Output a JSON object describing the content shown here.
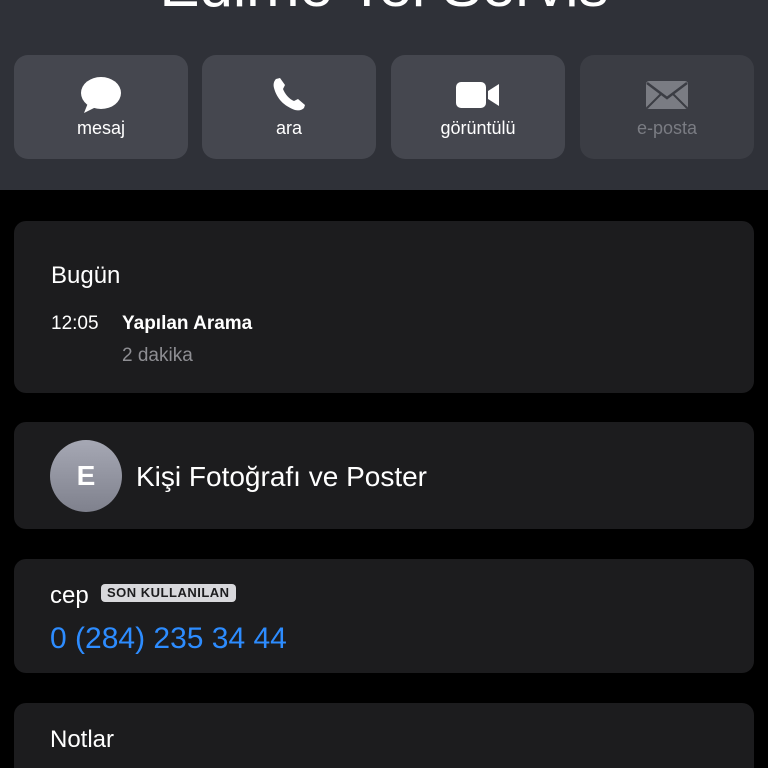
{
  "contact": {
    "name": "Edirne Tel Servis",
    "initial": "E"
  },
  "actions": [
    {
      "label": "mesaj",
      "icon": "message-bubble-icon",
      "enabled": true
    },
    {
      "label": "ara",
      "icon": "phone-icon",
      "enabled": true
    },
    {
      "label": "görüntülü",
      "icon": "video-camera-icon",
      "enabled": true
    },
    {
      "label": "e-posta",
      "icon": "envelope-icon",
      "enabled": false
    }
  ],
  "recents": {
    "title": "Bugün",
    "entries": [
      {
        "time": "12:05",
        "type": "Yapılan Arama",
        "duration": "2 dakika"
      }
    ]
  },
  "photo_poster": {
    "label": "Kişi Fotoğrafı ve Poster"
  },
  "phone": {
    "kind": "cep",
    "badge": "SON KULLANILAN",
    "number": "0 (284) 235 34 44"
  },
  "notes": {
    "title": "Notlar"
  },
  "colors": {
    "background": "#000000",
    "header": "#2f3138",
    "card": "#1c1c1e",
    "action_button": "#45474f",
    "link_blue": "#2d8cff",
    "secondary_text": "#8e8e93"
  }
}
